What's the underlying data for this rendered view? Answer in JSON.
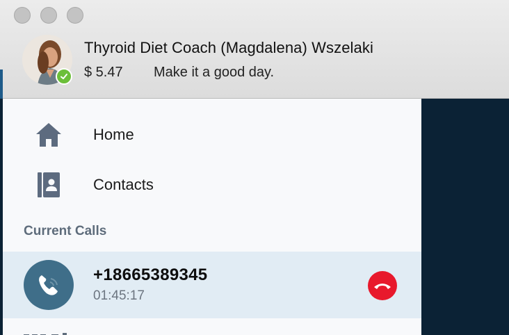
{
  "window": {
    "buttons": [
      "close",
      "minimize",
      "zoom"
    ]
  },
  "profile": {
    "name": "Thyroid Diet Coach (Magdalena) Wszelaki",
    "credit": "$ 5.47",
    "mood_message": "Make it a good day.",
    "status": "online",
    "status_color": "#6cbf3a"
  },
  "sidebar": {
    "items": [
      {
        "label": "Home",
        "icon": "home-icon"
      },
      {
        "label": "Contacts",
        "icon": "contacts-book-icon"
      }
    ],
    "section_title": "Current Calls"
  },
  "current_call": {
    "number": "+18665389345",
    "duration": "01:45:17",
    "icon": "phone-icon",
    "hangup_icon": "hang-up-icon",
    "hangup_color": "#e8192c",
    "row_bg": "#e1ecf4"
  },
  "colors": {
    "accent": "#3f6e89",
    "icon_gray": "#5d6b7f",
    "dark_bg": "#0b2235"
  }
}
